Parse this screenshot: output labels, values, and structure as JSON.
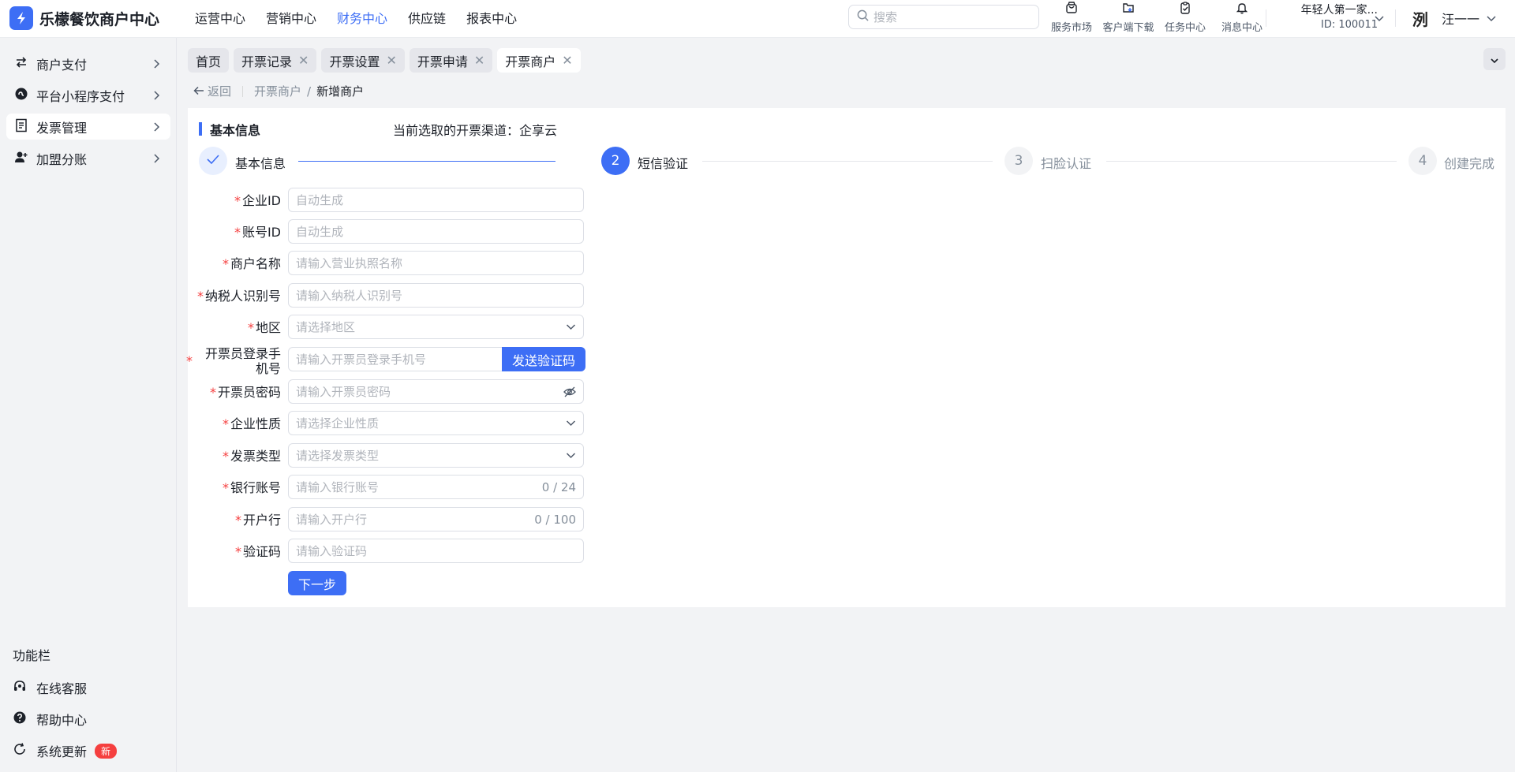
{
  "app": {
    "title": "乐檬餐饮商户中心"
  },
  "topnav": {
    "items": [
      "运营中心",
      "营销中心",
      "财务中心",
      "供应链",
      "报表中心"
    ],
    "active": "财务中心"
  },
  "search": {
    "placeholder": "搜索"
  },
  "tools": [
    {
      "label": "服务市场",
      "icon": "shop-bag-icon"
    },
    {
      "label": "客户端下载",
      "icon": "download-folder-icon"
    },
    {
      "label": "任务中心",
      "icon": "clipboard-icon"
    },
    {
      "label": "消息中心",
      "icon": "bell-icon"
    }
  ],
  "store": {
    "name": "年轻人第一家...",
    "id": "ID: 100011"
  },
  "user": {
    "avatar_text": "洌",
    "name": "汪一一"
  },
  "sidebar": {
    "items": [
      {
        "label": "商户支付",
        "icon": "transfer-arrows-icon"
      },
      {
        "label": "平台小程序支付",
        "icon": "mini-program-icon"
      },
      {
        "label": "发票管理",
        "icon": "receipt-icon",
        "active": true
      },
      {
        "label": "加盟分账",
        "icon": "user-add-icon"
      }
    ],
    "section_title": "功能栏",
    "functions": [
      {
        "label": "在线客服",
        "icon": "headset-icon"
      },
      {
        "label": "帮助中心",
        "icon": "help-circle-icon"
      },
      {
        "label": "系统更新",
        "icon": "refresh-icon",
        "badge": "新"
      }
    ]
  },
  "tabs": [
    {
      "label": "首页",
      "closable": false
    },
    {
      "label": "开票记录",
      "closable": true
    },
    {
      "label": "开票设置",
      "closable": true
    },
    {
      "label": "开票申请",
      "closable": true
    },
    {
      "label": "开票商户",
      "closable": true,
      "active": true
    }
  ],
  "breadcrumb": {
    "back": "返回",
    "parent": "开票商户",
    "separator": "/",
    "current": "新增商户"
  },
  "section": {
    "title": "基本信息",
    "channel_text": "当前选取的开票渠道：企享云"
  },
  "steps": [
    {
      "number": "1",
      "label": "基本信息",
      "status": "done"
    },
    {
      "number": "2",
      "label": "短信验证",
      "status": "current"
    },
    {
      "number": "3",
      "label": "扫脸认证",
      "status": "todo"
    },
    {
      "number": "4",
      "label": "创建完成",
      "status": "todo"
    }
  ],
  "form": {
    "fields": [
      {
        "label": "企业ID",
        "placeholder": "自动生成",
        "type": "text"
      },
      {
        "label": "账号ID",
        "placeholder": "自动生成",
        "type": "text"
      },
      {
        "label": "商户名称",
        "placeholder": "请输入营业执照名称",
        "type": "text"
      },
      {
        "label": "纳税人识别号",
        "placeholder": "请输入纳税人识别号",
        "type": "text"
      },
      {
        "label": "地区",
        "placeholder": "请选择地区",
        "type": "select"
      },
      {
        "label": "开票员登录手机号",
        "placeholder": "请输入开票员登录手机号",
        "type": "sms",
        "button": "发送验证码"
      },
      {
        "label": "开票员密码",
        "placeholder": "请输入开票员密码",
        "type": "password"
      },
      {
        "label": "企业性质",
        "placeholder": "请选择企业性质",
        "type": "select"
      },
      {
        "label": "发票类型",
        "placeholder": "请选择发票类型",
        "type": "select"
      },
      {
        "label": "银行账号",
        "placeholder": "请输入银行账号",
        "type": "count",
        "count": "0 / 24"
      },
      {
        "label": "开户行",
        "placeholder": "请输入开户行",
        "type": "count",
        "count": "0 / 100"
      },
      {
        "label": "验证码",
        "placeholder": "请输入验证码",
        "type": "text"
      }
    ],
    "next_button": "下一步"
  },
  "colors": {
    "primary": "#3d6ef5",
    "required": "#f53f3f",
    "badge": "#f53f3f"
  }
}
